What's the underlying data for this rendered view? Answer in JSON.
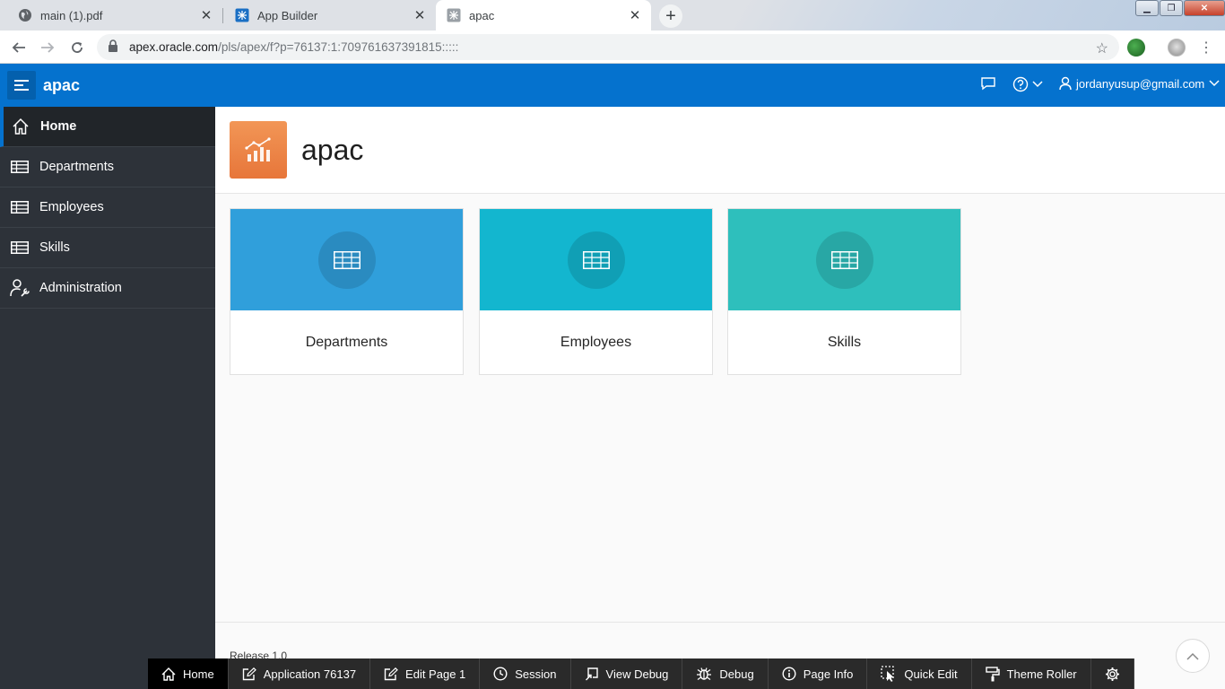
{
  "browser": {
    "tabs": [
      {
        "title": "main (1).pdf",
        "icon": "globe-icon"
      },
      {
        "title": "App Builder",
        "icon": "apex-icon"
      },
      {
        "title": "apac",
        "icon": "apex-icon",
        "active": true
      }
    ],
    "url_host": "apex.oracle.com",
    "url_path": "/pls/apex/f?p=76137:1:709761637391815:::::"
  },
  "header": {
    "app_name": "apac",
    "user": "jordanyusup@gmail.com"
  },
  "sidebar": {
    "items": [
      {
        "label": "Home",
        "icon": "home-icon",
        "active": true
      },
      {
        "label": "Departments",
        "icon": "table-icon"
      },
      {
        "label": "Employees",
        "icon": "table-icon"
      },
      {
        "label": "Skills",
        "icon": "table-icon"
      },
      {
        "label": "Administration",
        "icon": "user-wrench-icon"
      }
    ]
  },
  "main": {
    "title": "apac",
    "cards": [
      {
        "label": "Departments",
        "color": "#309fdb"
      },
      {
        "label": "Employees",
        "color": "#13b6cf"
      },
      {
        "label": "Skills",
        "color": "#2ebfbc"
      }
    ],
    "release": "Release 1.0"
  },
  "devbar": {
    "items": [
      {
        "label": "Home",
        "icon": "home-icon"
      },
      {
        "label": "Application 76137",
        "icon": "edit-icon"
      },
      {
        "label": "Edit Page 1",
        "icon": "edit-icon"
      },
      {
        "label": "Session",
        "icon": "clock-icon"
      },
      {
        "label": "View Debug",
        "icon": "view-debug-icon"
      },
      {
        "label": "Debug",
        "icon": "bug-icon"
      },
      {
        "label": "Page Info",
        "icon": "info-icon"
      },
      {
        "label": "Quick Edit",
        "icon": "quick-edit-icon"
      },
      {
        "label": "Theme Roller",
        "icon": "paint-roller-icon"
      }
    ]
  },
  "colors": {
    "header": "#0572ce",
    "sidebar": "#2d3239",
    "hero_icon": "#ee8745"
  }
}
